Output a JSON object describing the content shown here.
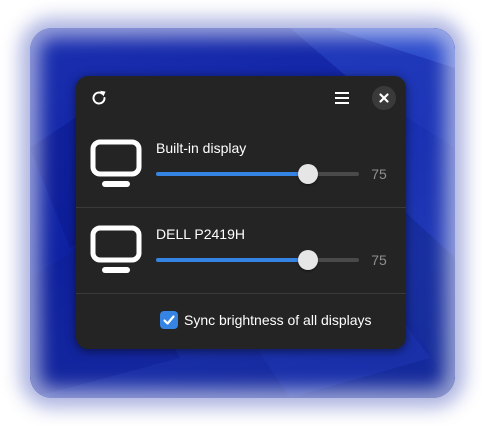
{
  "header": {
    "refresh_icon": "refresh-icon",
    "menu_icon": "hamburger-menu-icon",
    "close_icon": "close-icon"
  },
  "displays": [
    {
      "name": "Built-in display",
      "brightness": 75,
      "brightness_label": "75",
      "icon": "monitor-icon"
    },
    {
      "name": "DELL P2419H",
      "brightness": 75,
      "brightness_label": "75",
      "icon": "monitor-icon"
    }
  ],
  "sync": {
    "label": "Sync brightness of all displays",
    "checked": true
  },
  "colors": {
    "accent": "#3584e4",
    "panel_bg": "#242424",
    "wallpaper": "#1a2ba8"
  }
}
